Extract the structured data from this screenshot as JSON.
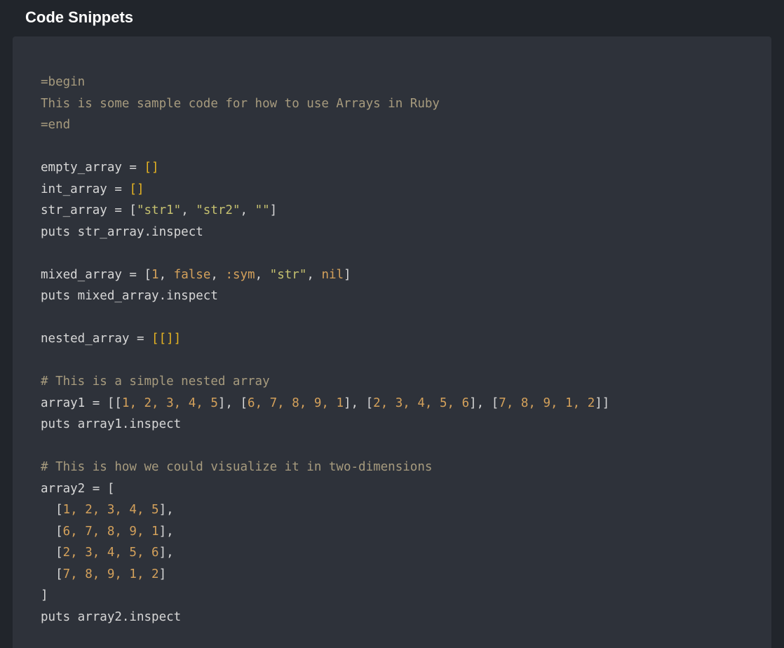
{
  "header": {
    "title": "Code Snippets"
  },
  "code": {
    "l1": "=begin",
    "l2": "This is some sample code for how to use Arrays in Ruby",
    "l3": "=end",
    "l4": "",
    "l5a": "empty_array = ",
    "l5b": "[]",
    "l6a": "int_array = ",
    "l6b": "[]",
    "l7a": "str_array = [",
    "l7s1": "\"str1\"",
    "l7c1": ", ",
    "l7s2": "\"str2\"",
    "l7c2": ", ",
    "l7s3": "\"\"",
    "l7b": "]",
    "l8": "puts str_array.inspect",
    "l9": "",
    "l10a": "mixed_array = [",
    "l10n": "1",
    "l10c1": ", ",
    "l10k": "false",
    "l10c2": ", ",
    "l10sym": ":sym",
    "l10c3": ", ",
    "l10s": "\"str\"",
    "l10c4": ", ",
    "l10nil": "nil",
    "l10b": "]",
    "l11": "puts mixed_array.inspect",
    "l12": "",
    "l13a": "nested_array = ",
    "l13b": "[[]]",
    "l14": "",
    "l15": "# This is a simple nested array",
    "l16a": "array1 = [[",
    "l16v": "1, 2, 3, 4, 5",
    "l16b": "], [",
    "l16v2": "6, 7, 8, 9, 1",
    "l16c": "], [",
    "l16v3": "2, 3, 4, 5, 6",
    "l16d": "], [",
    "l16v4": "7, 8, 9, 1, 2",
    "l16e": "]]",
    "l17": "puts array1.inspect",
    "l18": "",
    "l19": "# This is how we could visualize it in two-dimensions",
    "l20": "array2 = [",
    "l21a": "  [",
    "l21v": "1, 2, 3, 4, 5",
    "l21b": "],",
    "l22a": "  [",
    "l22v": "6, 7, 8, 9, 1",
    "l22b": "],",
    "l23a": "  [",
    "l23v": "2, 3, 4, 5, 6",
    "l23b": "],",
    "l24a": "  [",
    "l24v": "7, 8, 9, 1, 2",
    "l24b": "]",
    "l25": "]",
    "l26": "puts array2.inspect"
  }
}
